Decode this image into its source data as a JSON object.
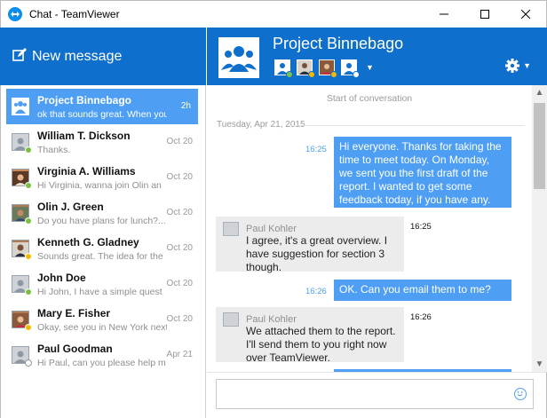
{
  "window": {
    "title": "Chat - TeamViewer"
  },
  "colors": {
    "accent": "#0e6fcd",
    "bubble": "#4e9ff3",
    "online": "#7ac143",
    "away": "#f5b800",
    "offline": "#ffffff"
  },
  "left": {
    "new_message_label": "New message",
    "conversations": [
      {
        "name": "Project Binnebago",
        "preview": "ok that sounds great. When you g",
        "date": "2h",
        "status": "none",
        "selected": true
      },
      {
        "name": "William T. Dickson",
        "preview": "Thanks.",
        "date": "Oct 20",
        "status": "online"
      },
      {
        "name": "Virginia A. Williams",
        "preview": "Hi Virginia, wanna join Olin an",
        "date": "Oct 20",
        "status": "online"
      },
      {
        "name": "Olin J. Green",
        "preview": "Do you have plans for lunch?...",
        "date": "Oct 20",
        "status": "online"
      },
      {
        "name": "Kenneth G. Gladney",
        "preview": "Sounds great. The idea for the",
        "date": "Oct 20",
        "status": "away"
      },
      {
        "name": "John Doe",
        "preview": "Hi John, I have a simple quest",
        "date": "Oct 20",
        "status": "online"
      },
      {
        "name": "Mary E. Fisher",
        "preview": "Okay, see you in New York next",
        "date": "Oct 20",
        "status": "away"
      },
      {
        "name": "Paul Goodman",
        "preview": "Hi Paul, can you please help m",
        "date": "Apr 21",
        "status": "offline"
      }
    ]
  },
  "chat": {
    "title": "Project Binnebago",
    "start_label": "Start of conversation",
    "date_label": "Tuesday, Apr 21, 2015",
    "messages": [
      {
        "dir": "out",
        "time": "16:25",
        "lines": [
          "Hi everyone. Thanks for taking the",
          "time to meet today. On Monday,",
          "we sent you the first draft of the",
          "report. I wanted to get some",
          "feedback today, if you have any."
        ]
      },
      {
        "dir": "in",
        "sender": "Paul Kohler",
        "time": "16:25",
        "lines": [
          "I agree, it's a great overview. I",
          "have suggestion for section 3",
          "though."
        ]
      },
      {
        "dir": "out",
        "time": "16:26",
        "lines": [
          "OK. Can you email them to me?"
        ]
      },
      {
        "dir": "in",
        "sender": "Paul Kohler",
        "time": "16:26",
        "lines": [
          "We attached them to the report.",
          "I'll send them to you right now",
          "over TeamViewer."
        ]
      }
    ]
  },
  "input": {
    "placeholder": "",
    "value": ""
  }
}
